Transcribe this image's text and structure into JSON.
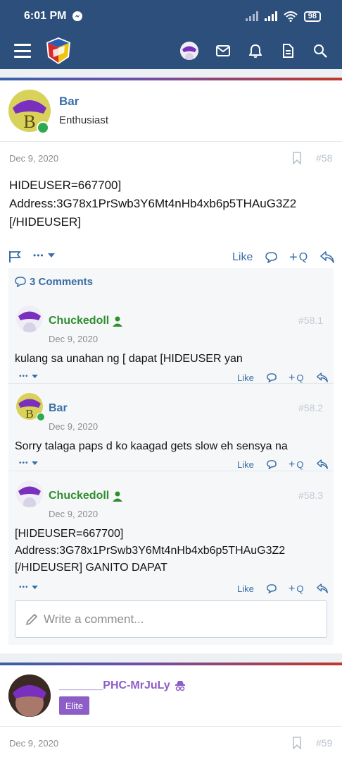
{
  "status_bar": {
    "time": "6:01 PM",
    "battery": "98"
  },
  "colors": {
    "nav_bg": "#2d4f7c",
    "link": "#3a6fa6",
    "green_name": "#2f8f2f",
    "purple_name": "#8e5ec7",
    "gold_name": "#c8a000"
  },
  "post1": {
    "author": "Bar",
    "avatar_letter": "B",
    "role": "Enthusiast",
    "date": "Dec 9, 2020",
    "number": "#58",
    "body": "HIDEUSER=667700]\nAddress:3G78x1PrSwb3Y6Mt4nHb4xb6p5THAuG3Z2\n[/HIDEUSER]",
    "like_label": "Like",
    "quote_label": "Q",
    "comments_count_label": "3 Comments",
    "more_label": "•••"
  },
  "comments": [
    {
      "author": "Chuckedoll",
      "date": "Dec 9, 2020",
      "number": "#58.1",
      "text": "kulang sa unahan ng [ dapat [HIDEUSER yan",
      "like_label": "Like",
      "quote_label": "Q"
    },
    {
      "author": "Bar",
      "avatar_letter": "B",
      "date": "Dec 9, 2020",
      "number": "#58.2",
      "text": "Sorry talaga paps d ko kaagad gets slow eh sensya na",
      "like_label": "Like",
      "quote_label": "Q"
    },
    {
      "author": "Chuckedoll",
      "date": "Dec 9, 2020",
      "number": "#58.3",
      "text": "[HIDEUSER=667700]\nAddress:3G78x1PrSwb3Y6Mt4nHb4xb6p5THAuG3Z2\n[/HIDEUSER] GANITO DAPAT",
      "like_label": "Like",
      "quote_label": "Q"
    }
  ],
  "comment_input": {
    "placeholder": "Write a comment..."
  },
  "post2": {
    "author": "_______PHC-MrJuLy",
    "badge": "Elite",
    "date": "Dec 9, 2020",
    "number": "#59"
  },
  "icons": {
    "menu": "hamburger-icon",
    "logo": "site-logo",
    "messages": "envelope-icon",
    "alerts": "bell-icon",
    "whats_new": "document-icon",
    "search": "search-icon",
    "bookmark": "bookmark-icon",
    "report": "flag-icon",
    "comment": "speech-bubble-icon",
    "reply": "reply-arrow-icon",
    "pencil": "pencil-icon"
  }
}
